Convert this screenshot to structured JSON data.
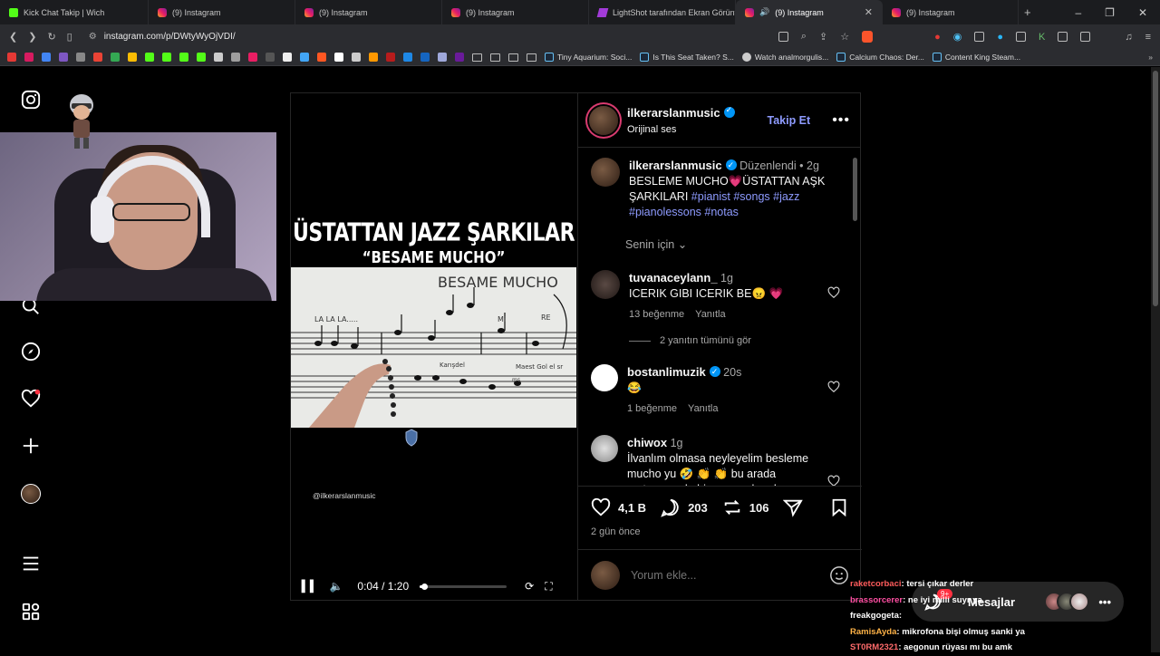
{
  "browser": {
    "tabs": [
      {
        "title": "Kick Chat Takip | Wich",
        "icon": "kick"
      },
      {
        "title": "(9) Instagram",
        "icon": "instagram"
      },
      {
        "title": "(9) Instagram",
        "icon": "instagram"
      },
      {
        "title": "(9) Instagram",
        "icon": "instagram"
      },
      {
        "title": "LightShot tarafından Ekran Görüntüs",
        "icon": "lightshot"
      },
      {
        "title": "(9) Instagram",
        "icon": "instagram",
        "active": true
      },
      {
        "title": "(9) Instagram",
        "icon": "instagram"
      }
    ],
    "url": "instagram.com/p/DWtyWyOjVDI/",
    "bookmarks": [
      "Tiny Aquarium: Soci...",
      "Is This Seat Taken? S...",
      "Watch analmorgulis...",
      "Calcium Chaos: Der...",
      "Content King Steam..."
    ]
  },
  "post": {
    "author": "ilkerarslanmusic",
    "audio": "Orijinal ses",
    "follow_label": "Takip Et",
    "caption": {
      "edited": "Düzenlendi",
      "age": "2g",
      "text": "BESLEME MUCHO💗ÜSTATTAN  AŞK ŞARKILARI",
      "hashtags": "#pianist #songs #jazz #pianolessons #notas"
    },
    "filter_label": "Senin için",
    "video": {
      "title": "ÜSTATTAN JAZZ ŞARKILAR",
      "subtitle": "“BESAME MUCHO”",
      "board_title": "BESAME MUCHO",
      "board_words": [
        "LA LA LA.....",
        "Mi",
        "RE",
        "Karışdel",
        "Maest Gol el sr",
        "ms"
      ],
      "credit": "@ilkerarslanmusic",
      "time": "0:04 / 1:20",
      "progress": 0.05
    },
    "comments": [
      {
        "user": "tuvanaceylann_",
        "age": "1g",
        "text": "ICERIK GIBI ICERIK BE😠 💗",
        "likes": "13 beğenme",
        "reply": "Yanıtla"
      },
      {
        "view_replies": "2 yanıtın tümünü gör"
      },
      {
        "user": "bostanlimuzik",
        "verified": true,
        "age": "20s",
        "text": "😂",
        "likes": "1 beğenme",
        "reply": "Yanıtla"
      },
      {
        "user": "chiwox",
        "age": "1g",
        "text": "İlvanlım olmasa neyleyelim besleme mucho yu 🤣 👏 👏  bu arada metronom da hiç şaşmadı o da ayrı"
      }
    ],
    "likes": "4,1 B",
    "comments_count": "203",
    "reposts": "106",
    "time_ago": "2 gün önce",
    "comment_placeholder": "Yorum ekle..."
  },
  "stream_chat": [
    {
      "user": "raketcorbaci",
      "msg": ": tersi çıkar derler"
    },
    {
      "user": "brassorcerer",
      "msg": ": ne iyi milli suyr ya"
    },
    {
      "user": "freakgogeta",
      "msg": ":"
    },
    {
      "user": "RamisAyda",
      "msg": ": mikrofona bişi olmuş sanki ya"
    },
    {
      "user": "ST0RM2321",
      "msg": ": aegonun rüyası mı bu amk"
    }
  ],
  "messages": {
    "label": "Mesajlar",
    "badge": "9+"
  },
  "colors": {
    "accent": "#8e9bff",
    "verified": "#0095f6",
    "notification": "#ff3040"
  }
}
